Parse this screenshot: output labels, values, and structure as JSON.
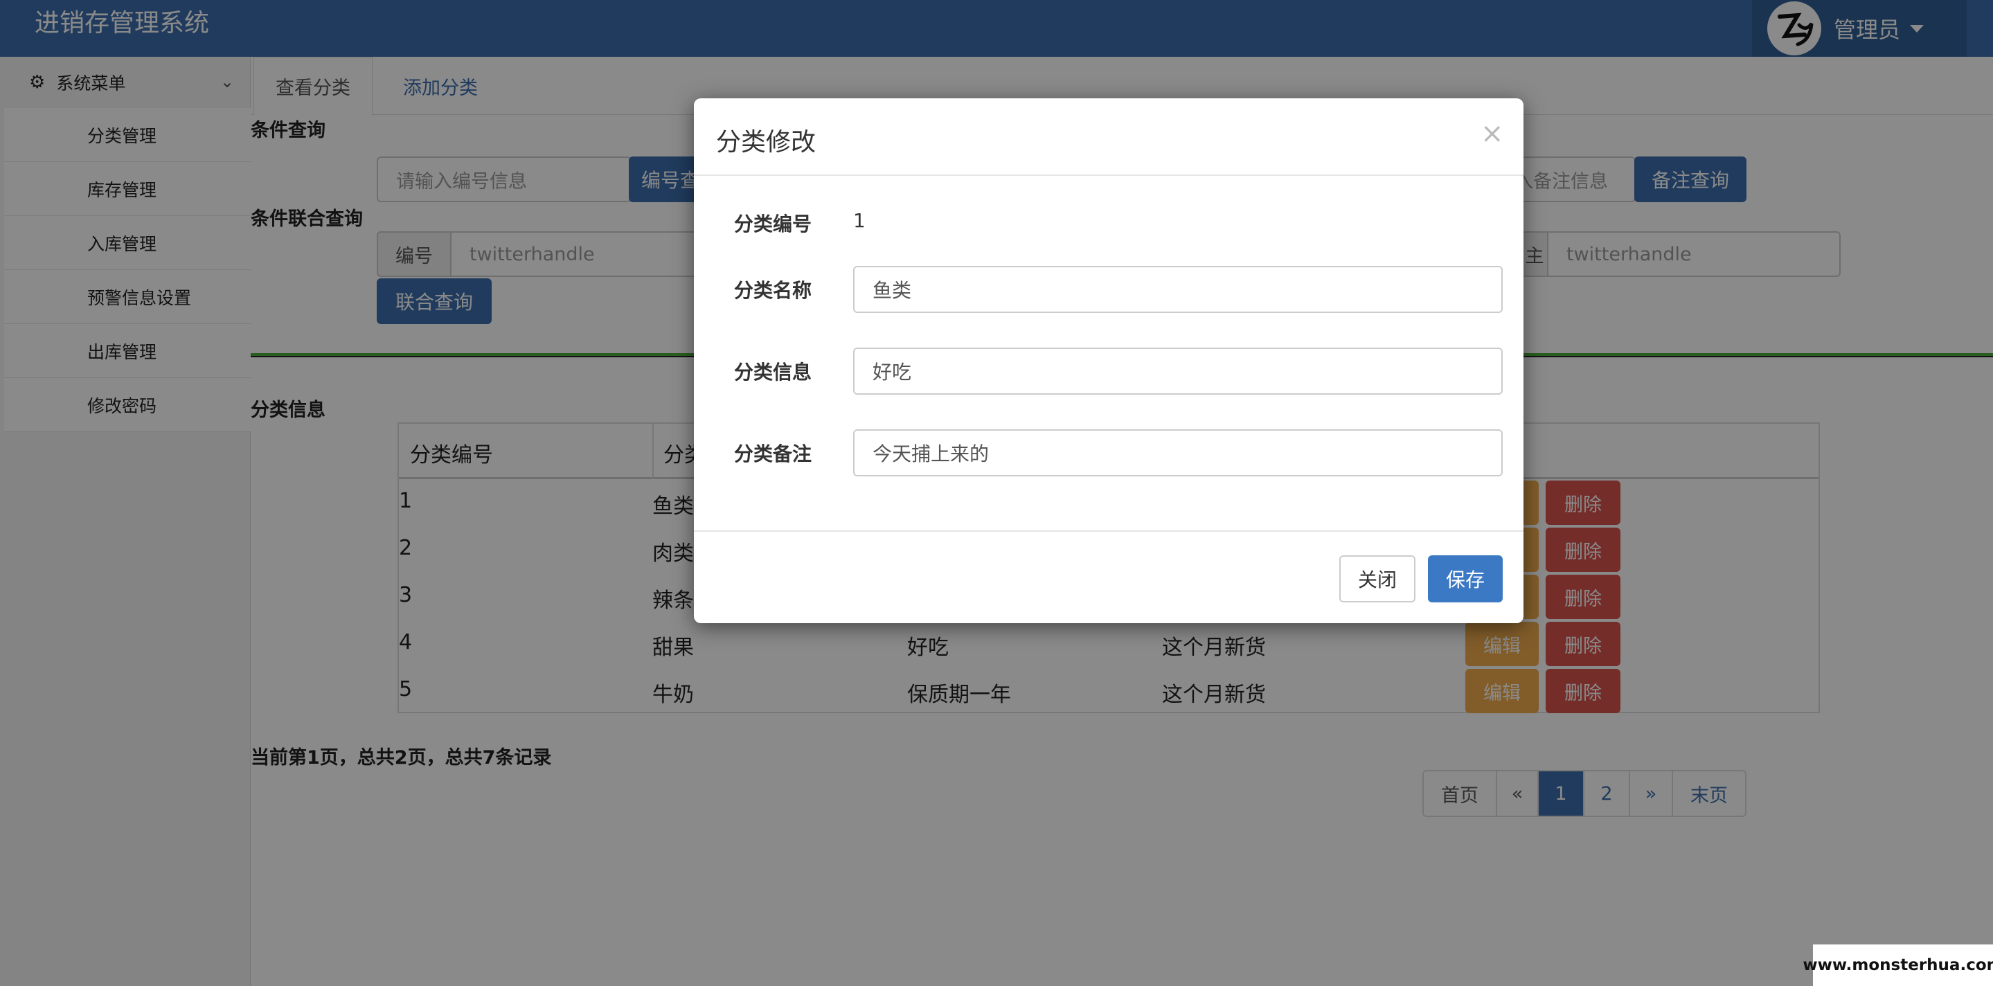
{
  "app": {
    "title": "进销存管理系统"
  },
  "user": {
    "name": "管理员"
  },
  "sidebar": {
    "header": "系统菜单",
    "items": [
      {
        "label": "分类管理"
      },
      {
        "label": "库存管理"
      },
      {
        "label": "入库管理"
      },
      {
        "label": "预警信息设置"
      },
      {
        "label": "出库管理"
      },
      {
        "label": "修改密码"
      }
    ]
  },
  "tabs": [
    {
      "label": "查看分类"
    },
    {
      "label": "添加分类"
    }
  ],
  "search": {
    "condition_label": "条件查询",
    "id_placeholder": "请输入编号信息",
    "id_button": "编号查",
    "remark_placeholder": "输入备注信息",
    "remark_button": "备注查询",
    "combined_label": "条件联合查询",
    "combined_id_addon": "编号",
    "combined_id_value": "twitterhandle",
    "combined_remark_addon": "主",
    "combined_remark_value": "twitterhandle",
    "combined_button": "联合查询"
  },
  "table": {
    "section_label": "分类信息",
    "headers": [
      "分类编号",
      "分类"
    ],
    "edit_label": "编辑",
    "delete_label": "删除",
    "rows": [
      {
        "id": "1",
        "name": "鱼类",
        "info": "",
        "remark": ""
      },
      {
        "id": "2",
        "name": "肉类",
        "info": "",
        "remark": ""
      },
      {
        "id": "3",
        "name": "辣条",
        "info": "",
        "remark": ""
      },
      {
        "id": "4",
        "name": "甜果",
        "info": "好吃",
        "remark": "这个月新货"
      },
      {
        "id": "5",
        "name": "牛奶",
        "info": "保质期一年",
        "remark": "这个月新货"
      }
    ]
  },
  "pagination": {
    "summary": "当前第1页，总共2页，总共7条记录",
    "first": "首页",
    "prev": "«",
    "pages": [
      "1",
      "2"
    ],
    "next": "»",
    "last": "末页",
    "current": "1"
  },
  "modal": {
    "title": "分类修改",
    "close_icon": "×",
    "fields": {
      "id_label": "分类编号",
      "id_value": "1",
      "name_label": "分类名称",
      "name_value": "鱼类",
      "info_label": "分类信息",
      "info_value": "好吃",
      "remark_label": "分类备注",
      "remark_value": "今天捕上来的"
    },
    "close_button": "关闭",
    "save_button": "保存"
  },
  "watermark": "www.monsterhua.com",
  "colors": {
    "primary": "#3c6eac",
    "warning": "#f0ad4e",
    "danger": "#d9534f",
    "divider": "#4fae3c"
  }
}
